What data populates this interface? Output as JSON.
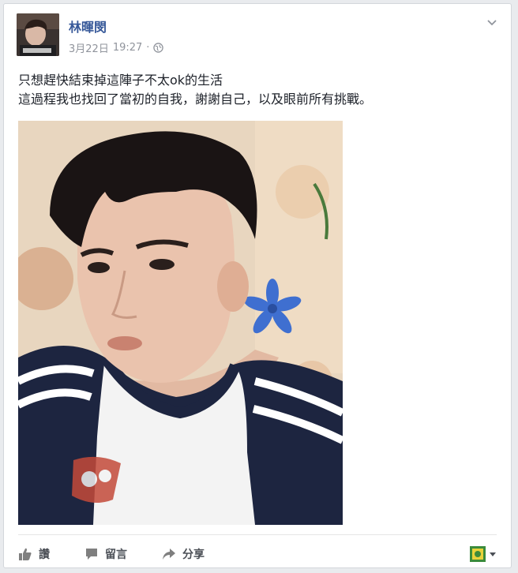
{
  "post": {
    "author": "林暉閔",
    "date": "3月22日",
    "time": "19:27",
    "separator": "·",
    "lines": [
      "只想趕快結束掉這陣子不太ok的生活",
      "這過程我也找回了當初的自我，謝謝自己，以及眼前所有挑戰。"
    ]
  },
  "actions": {
    "like": "讚",
    "comment": "留言",
    "share": "分享"
  },
  "icons": {
    "privacy": "globe-icon",
    "options": "chevron-down-icon",
    "like": "thumbs-up-icon",
    "comment": "speech-bubble-icon",
    "share": "share-arrow-icon",
    "audience": "page-avatar-icon"
  },
  "colors": {
    "author": "#365899",
    "meta": "#90949c",
    "text": "#1d2129",
    "action": "#4b4f56"
  }
}
